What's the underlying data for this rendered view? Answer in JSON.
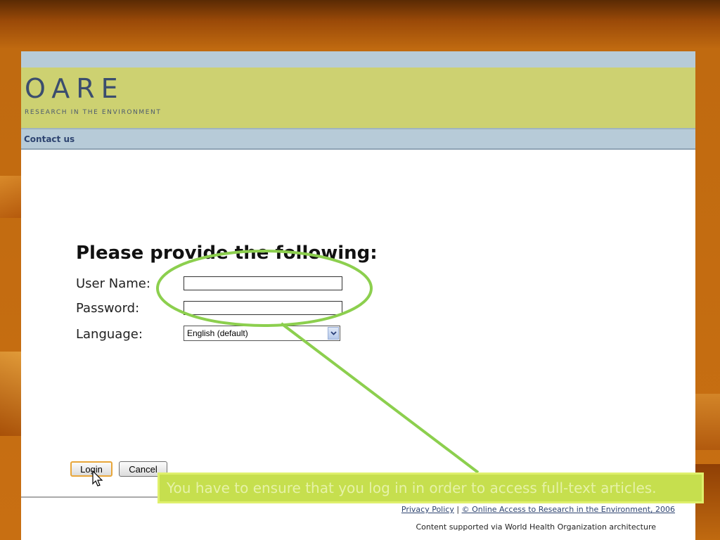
{
  "brand": {
    "logo_text": "OARE",
    "tagline": "RESEARCH IN THE ENVIRONMENT"
  },
  "nav": {
    "contact_label": "Contact us"
  },
  "form": {
    "title": "Please provide the following:",
    "username_label": "User Name:",
    "username_value": "",
    "password_label": "Password:",
    "password_value": "",
    "language_label": "Language:",
    "language_selected": "English (default)"
  },
  "buttons": {
    "login_label": "Login",
    "cancel_label": "Cancel"
  },
  "footer": {
    "privacy_link": "Privacy Policy",
    "separator": "|",
    "copyright_link": "© Online Access to Research in the Environment, 2006",
    "credit": "Content supported via World Health Organization architecture"
  },
  "annotation": {
    "callout_text": "You have to ensure that you log in in order to access full-text articles.",
    "highlight_color": "#8ccf4e"
  },
  "colors": {
    "header_bg": "#cdd171",
    "nav_bg": "#b7cbd8",
    "logo_text": "#3b4d6e",
    "callout_bg": "#c6df4e"
  }
}
